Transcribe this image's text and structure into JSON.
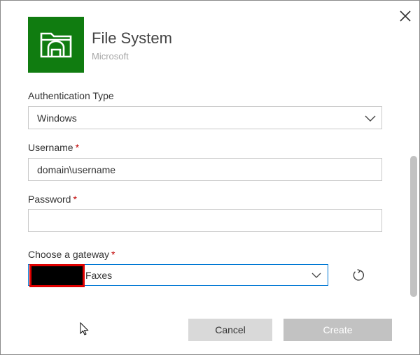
{
  "connector": {
    "name": "File System",
    "publisher": "Microsoft",
    "logo_icon": "folder-icon",
    "logo_color": "#107c10"
  },
  "form": {
    "auth_type": {
      "label": "Authentication Type",
      "value": "Windows"
    },
    "username": {
      "label": "Username",
      "required_mark": "*",
      "value": "domain\\username"
    },
    "password": {
      "label": "Password",
      "required_mark": "*",
      "value": ""
    },
    "gateway": {
      "label": "Choose a gateway",
      "required_mark": "*",
      "value": "Faxes"
    }
  },
  "buttons": {
    "cancel": "Cancel",
    "create": "Create"
  },
  "icons": {
    "close": "close-icon",
    "refresh": "refresh-icon",
    "chevron": "chevron-down-icon"
  },
  "colors": {
    "accent": "#0078d4",
    "required": "#c00000",
    "redaction_border": "#e00000"
  }
}
